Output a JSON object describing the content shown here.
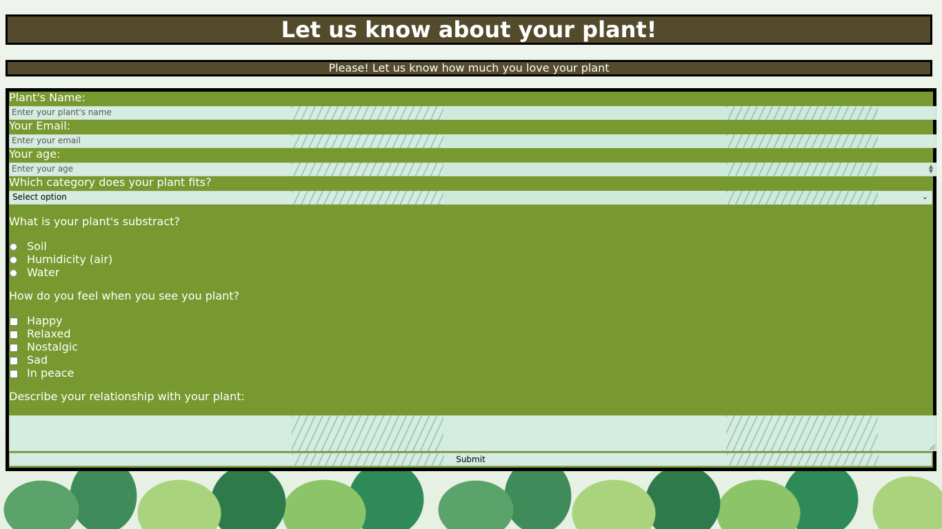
{
  "header": {
    "title": "Let us know about your plant!",
    "subtitle": "Please! Let us know how much you love your plant"
  },
  "form": {
    "name_label": "Plant's Name:",
    "name_placeholder": "Enter your plant's name",
    "email_label": "Your Email:",
    "email_placeholder": "Enter your email",
    "age_label": "Your age:",
    "age_placeholder": "Enter your age",
    "category_label": "Which category does your plant fits?",
    "category_selected": "Select option",
    "substract_question": "What is your plant's substract?",
    "substract_options": [
      "Soil",
      "Humidicity (air)",
      "Water"
    ],
    "feel_question": "How do you feel when you see you plant?",
    "feel_options": [
      "Happy",
      "Relaxed",
      "Nostalgic",
      "Sad",
      "In peace"
    ],
    "relationship_label": "Describe your relationship with your plant:",
    "submit_label": "Submit"
  },
  "icons": {
    "select_chevron": "chevron-down-icon",
    "age_spinner": "spinner-icon"
  },
  "colors": {
    "banner_bg": "#534b2c",
    "form_bg": "#77992f",
    "border": "#000000",
    "text": "#ffffff"
  }
}
